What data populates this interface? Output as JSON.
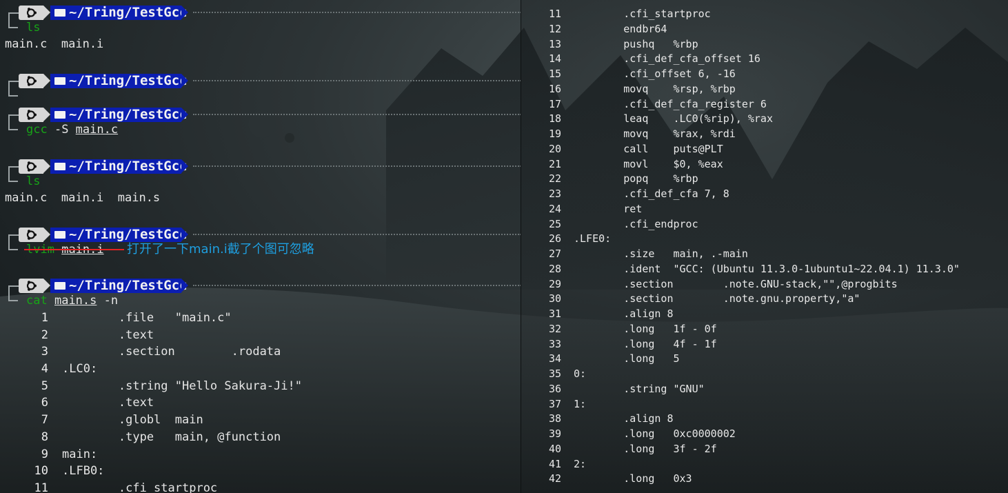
{
  "prompt": {
    "path": "~/Tring/TestGcc"
  },
  "left_terminal": {
    "blocks": [
      {
        "command": "ls",
        "cmd_parts": [
          {
            "t": "ls",
            "c": "green"
          }
        ],
        "output": [
          "main.c  main.i"
        ]
      },
      {
        "command": "",
        "cmd_parts": [],
        "output": []
      },
      {
        "command": "gcc -S main.c",
        "cmd_parts": [
          {
            "t": "gcc",
            "c": "green"
          },
          {
            "t": " -S ",
            "c": ""
          },
          {
            "t": "main.c",
            "c": "ul"
          }
        ],
        "output": []
      },
      {
        "command": "ls",
        "cmd_parts": [
          {
            "t": "ls",
            "c": "green"
          }
        ],
        "output": [
          "main.c  main.i  main.s"
        ]
      },
      {
        "command": "lvim main.i",
        "cmd_parts": [
          {
            "t": "lvim",
            "c": "green"
          },
          {
            "t": " ",
            "c": ""
          },
          {
            "t": "main.i",
            "c": "ul"
          }
        ],
        "output": [],
        "annotation": "打开了一下main.i截了个图可忽略"
      },
      {
        "command": "cat main.s -n",
        "cmd_parts": [
          {
            "t": "cat",
            "c": "green"
          },
          {
            "t": " ",
            "c": ""
          },
          {
            "t": "main.s",
            "c": "ul"
          },
          {
            "t": " -n",
            "c": ""
          }
        ],
        "output": []
      }
    ],
    "listing": [
      {
        "n": "1",
        "text": "        .file   \"main.c\""
      },
      {
        "n": "2",
        "text": "        .text"
      },
      {
        "n": "3",
        "text": "        .section        .rodata"
      },
      {
        "n": "4",
        "text": ".LC0:"
      },
      {
        "n": "5",
        "text": "        .string \"Hello Sakura-Ji!\""
      },
      {
        "n": "6",
        "text": "        .text"
      },
      {
        "n": "7",
        "text": "        .globl  main"
      },
      {
        "n": "8",
        "text": "        .type   main, @function"
      },
      {
        "n": "9",
        "text": "main:"
      },
      {
        "n": "10",
        "text": ".LFB0:"
      },
      {
        "n": "11",
        "text": "        .cfi_startproc"
      }
    ]
  },
  "right_terminal": {
    "listing": [
      {
        "n": "11",
        "text": "        .cfi_startproc"
      },
      {
        "n": "12",
        "text": "        endbr64"
      },
      {
        "n": "13",
        "text": "        pushq   %rbp"
      },
      {
        "n": "14",
        "text": "        .cfi_def_cfa_offset 16"
      },
      {
        "n": "15",
        "text": "        .cfi_offset 6, -16"
      },
      {
        "n": "16",
        "text": "        movq    %rsp, %rbp"
      },
      {
        "n": "17",
        "text": "        .cfi_def_cfa_register 6"
      },
      {
        "n": "18",
        "text": "        leaq    .LC0(%rip), %rax"
      },
      {
        "n": "19",
        "text": "        movq    %rax, %rdi"
      },
      {
        "n": "20",
        "text": "        call    puts@PLT"
      },
      {
        "n": "21",
        "text": "        movl    $0, %eax"
      },
      {
        "n": "22",
        "text": "        popq    %rbp"
      },
      {
        "n": "23",
        "text": "        .cfi_def_cfa 7, 8"
      },
      {
        "n": "24",
        "text": "        ret"
      },
      {
        "n": "25",
        "text": "        .cfi_endproc"
      },
      {
        "n": "26",
        "text": ".LFE0:"
      },
      {
        "n": "27",
        "text": "        .size   main, .-main"
      },
      {
        "n": "28",
        "text": "        .ident  \"GCC: (Ubuntu 11.3.0-1ubuntu1~22.04.1) 11.3.0\""
      },
      {
        "n": "29",
        "text": "        .section        .note.GNU-stack,\"\",@progbits"
      },
      {
        "n": "30",
        "text": "        .section        .note.gnu.property,\"a\""
      },
      {
        "n": "31",
        "text": "        .align 8"
      },
      {
        "n": "32",
        "text": "        .long   1f - 0f"
      },
      {
        "n": "33",
        "text": "        .long   4f - 1f"
      },
      {
        "n": "34",
        "text": "        .long   5"
      },
      {
        "n": "35",
        "text": "0:"
      },
      {
        "n": "36",
        "text": "        .string \"GNU\""
      },
      {
        "n": "37",
        "text": "1:"
      },
      {
        "n": "38",
        "text": "        .align 8"
      },
      {
        "n": "39",
        "text": "        .long   0xc0000002"
      },
      {
        "n": "40",
        "text": "        .long   3f - 2f"
      },
      {
        "n": "41",
        "text": "2:"
      },
      {
        "n": "42",
        "text": "        .long   0x3"
      }
    ]
  },
  "colors": {
    "path_bg": "#0b1eb1",
    "os_bg": "#d7d7d7",
    "command_green": "#17a317",
    "annotation_blue": "#1e9fe0",
    "strike_red": "#e52222"
  },
  "icons": {
    "os": "ubuntu-logo-icon",
    "folder": "folder-icon"
  }
}
